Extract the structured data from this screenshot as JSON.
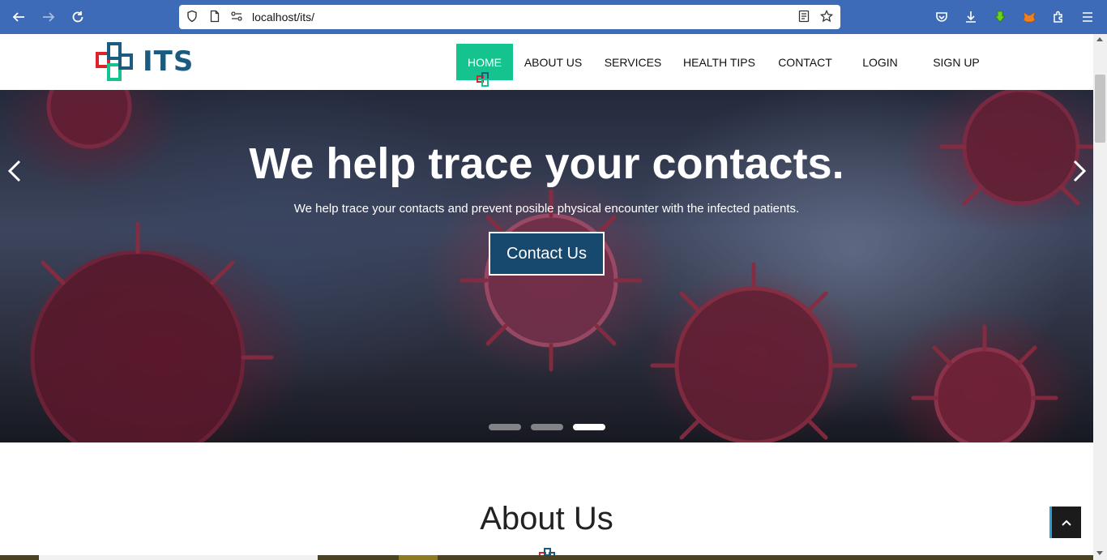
{
  "browser": {
    "url": "localhost/its/"
  },
  "nav": {
    "logo_text": "ITS",
    "items": [
      {
        "label": "HOME",
        "active": true
      },
      {
        "label": "ABOUT US"
      },
      {
        "label": "SERVICES"
      },
      {
        "label": "HEALTH TIPS"
      },
      {
        "label": "CONTACT"
      },
      {
        "label": "LOGIN"
      },
      {
        "label": "SIGN UP"
      }
    ],
    "active_color": "#14c38e"
  },
  "hero": {
    "title": "We help trace your contacts.",
    "subtitle": "We help trace your contacts and prevent posible physical encounter with the infected patients.",
    "button_label": "Contact Us",
    "button_color": "#17496e",
    "slide_count": 3,
    "active_slide": 3
  },
  "about": {
    "title": "About Us"
  },
  "colors": {
    "browser_toolbar": "#3d6bb8",
    "brand_blue": "#1b5b7f",
    "brand_red": "#e0202a",
    "brand_green": "#14c38e"
  },
  "icons": {
    "back": "arrow-left-icon",
    "forward": "arrow-right-icon",
    "reload": "reload-icon",
    "shield": "shield-icon",
    "page": "page-icon",
    "permissions": "permissions-icon",
    "reader": "reader-view-icon",
    "bookmark": "star-icon",
    "pocket": "pocket-icon",
    "downloads": "download-icon",
    "extension1": "green-arrow-extension-icon",
    "extension2": "metamask-fox-icon",
    "extensions": "puzzle-icon",
    "menu": "hamburger-menu-icon"
  }
}
